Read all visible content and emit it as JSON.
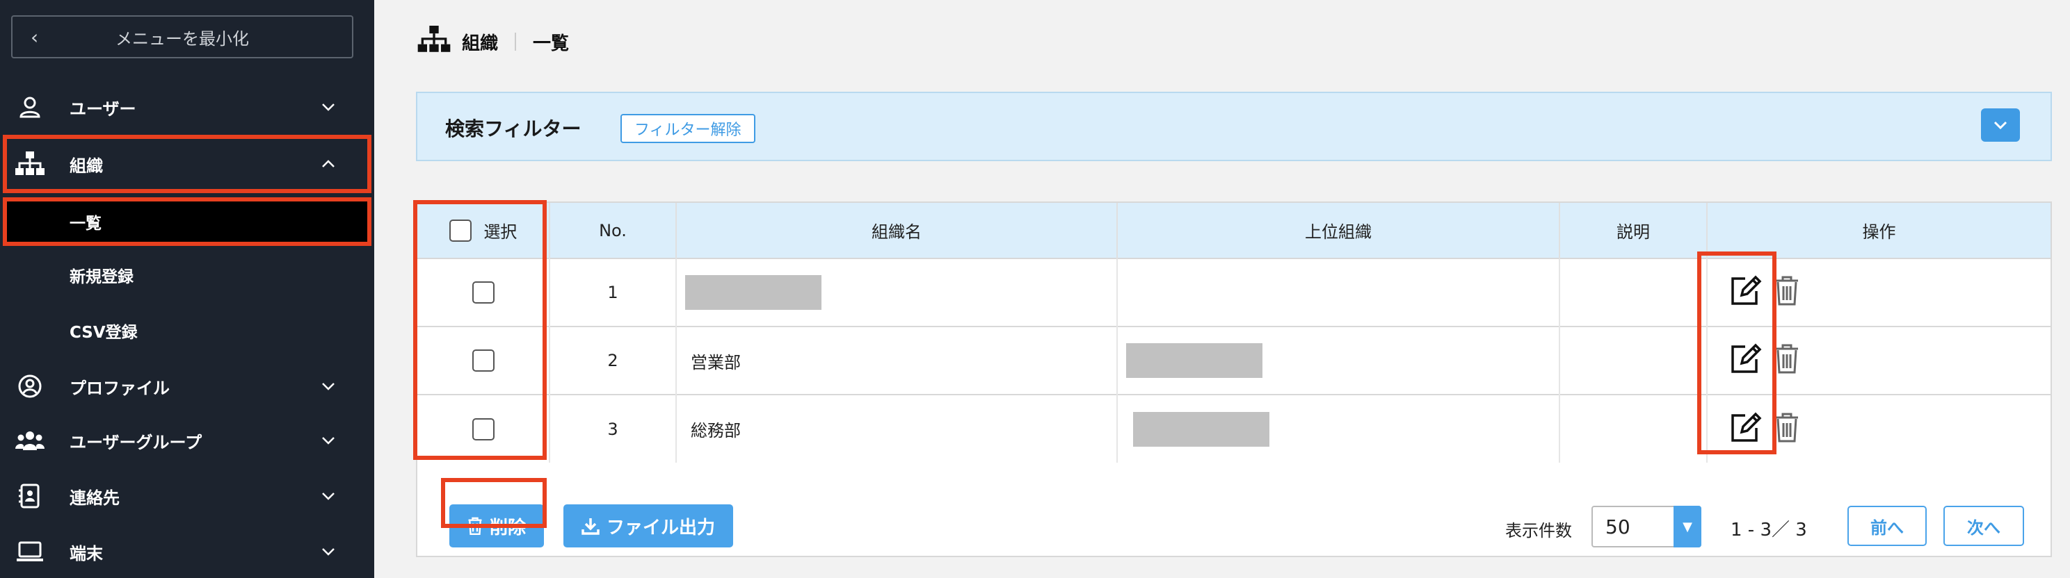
{
  "sidebar": {
    "collapse_label": "メニューを最小化",
    "items": [
      {
        "label": "ユーザー",
        "icon": "user-icon"
      },
      {
        "label": "組織",
        "icon": "org-chart-icon",
        "expanded": true
      },
      {
        "label": "プロファイル",
        "icon": "profile-icon"
      },
      {
        "label": "ユーザーグループ",
        "icon": "users-group-icon"
      },
      {
        "label": "連絡先",
        "icon": "contact-book-icon"
      },
      {
        "label": "端末",
        "icon": "laptop-icon"
      }
    ],
    "sub_items": [
      "一覧",
      "新規登録",
      "CSV登録"
    ]
  },
  "header": {
    "section": "組織",
    "page": "一覧"
  },
  "filter": {
    "title": "検索フィルター",
    "clear_label": "フィルター解除"
  },
  "table": {
    "columns": [
      "選択",
      "No.",
      "組織名",
      "上位組織",
      "説明",
      "操作"
    ],
    "rows": [
      {
        "no": "1",
        "name": "",
        "parent": "",
        "desc": ""
      },
      {
        "no": "2",
        "name": "営業部",
        "parent": "",
        "desc": ""
      },
      {
        "no": "3",
        "name": "総務部",
        "parent": "",
        "desc": ""
      }
    ]
  },
  "footer": {
    "delete_label": "削除",
    "export_label": "ファイル出力",
    "per_page_label": "表示件数",
    "per_page_value": "50",
    "range": "1 - 3／ 3",
    "prev_label": "前へ",
    "next_label": "次へ"
  },
  "colors": {
    "accent": "#4aa3ea",
    "highlight": "#e8401f",
    "sidebar_bg": "#1c232e"
  }
}
